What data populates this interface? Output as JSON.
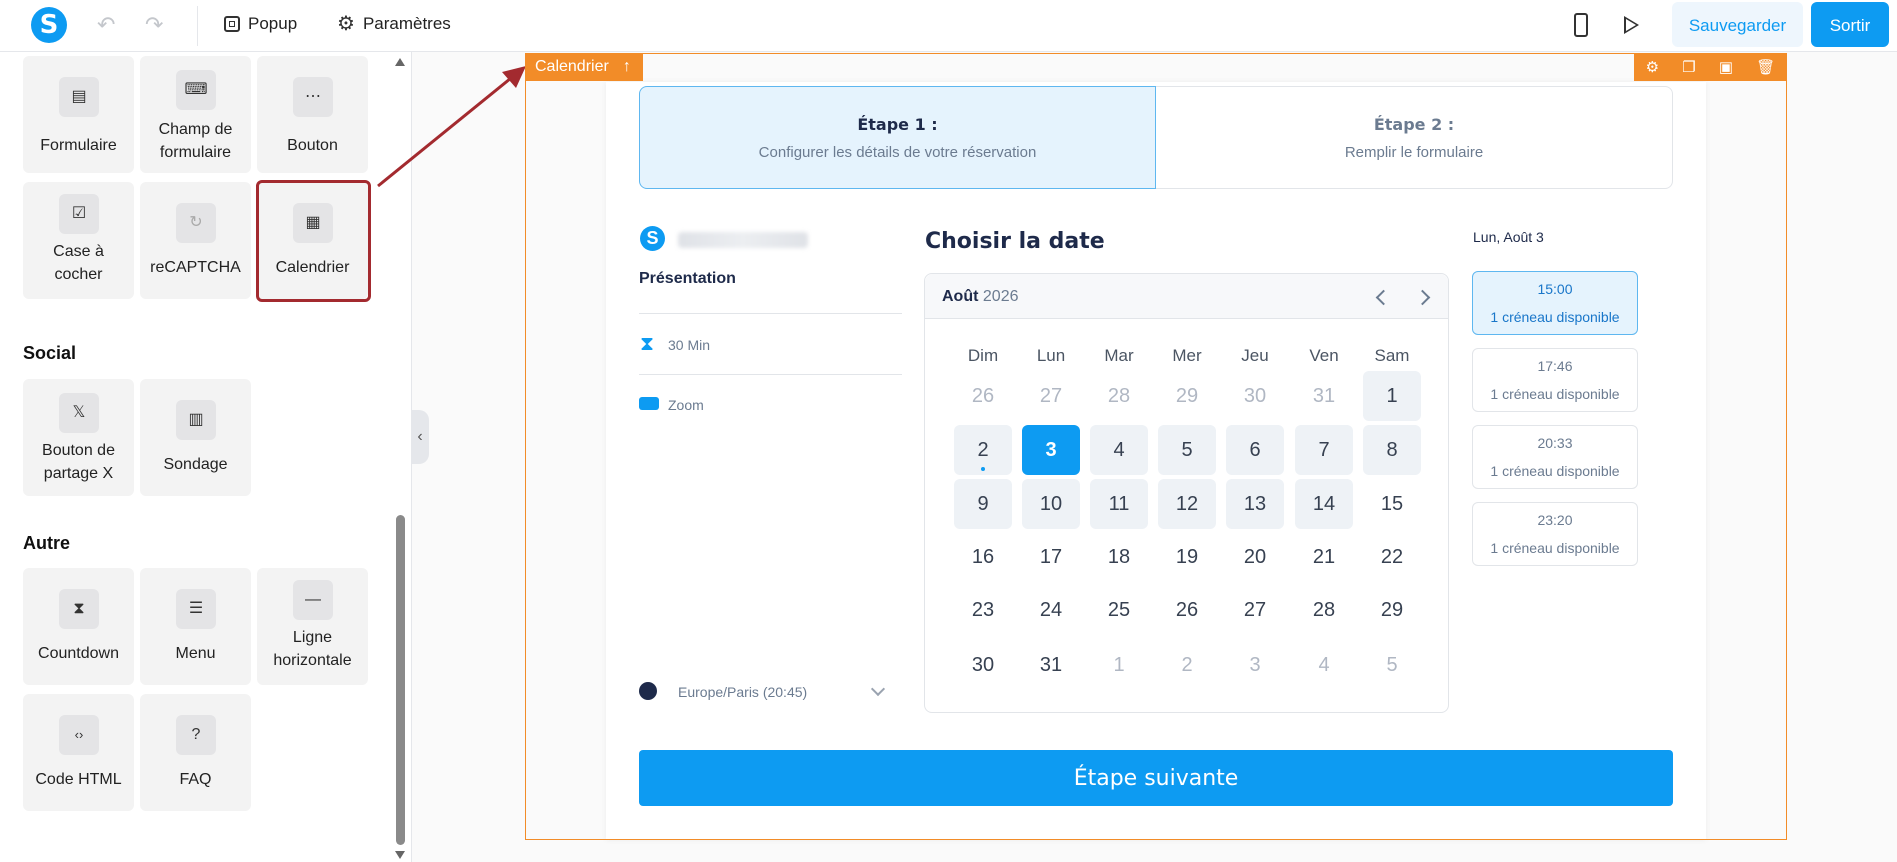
{
  "topbar": {
    "logo": "S",
    "undo": "↶",
    "redo": "↷",
    "popup_label": "Popup",
    "settings_label": "Paramètres",
    "save_label": "Sauvegarder",
    "exit_label": "Sortir"
  },
  "sidebar": {
    "items": [
      {
        "label": "Formulaire",
        "icon": "form-icon",
        "glyph": "▤"
      },
      {
        "label": "Champ de formulaire",
        "icon": "form-field-icon",
        "glyph": "⌨"
      },
      {
        "label": "Bouton",
        "icon": "button-icon",
        "glyph": "⋯"
      },
      {
        "label": "Case à cocher",
        "icon": "checkbox-icon",
        "glyph": "☑"
      },
      {
        "label": "reCAPTCHA",
        "icon": "recaptcha-icon",
        "glyph": "↻"
      },
      {
        "label": "Calendrier",
        "icon": "calendar-icon",
        "glyph": "▦"
      }
    ],
    "social_title": "Social",
    "social": [
      {
        "label": "Bouton de partage X",
        "icon": "x-share-icon",
        "glyph": "𝕏"
      },
      {
        "label": "Sondage",
        "icon": "poll-icon",
        "glyph": "▥"
      }
    ],
    "other_title": "Autre",
    "other": [
      {
        "label": "Countdown",
        "icon": "hourglass-icon",
        "glyph": "⧗"
      },
      {
        "label": "Menu",
        "icon": "menu-icon",
        "glyph": "☰"
      },
      {
        "label": "Ligne horizontale",
        "icon": "horizontal-line-icon",
        "glyph": "—"
      },
      {
        "label": "Code HTML",
        "icon": "code-icon",
        "glyph": "‹›"
      },
      {
        "label": "FAQ",
        "icon": "question-icon",
        "glyph": "?"
      }
    ]
  },
  "canvas": {
    "element_tag": "Calendrier",
    "tag_arrow": "↑",
    "steps": [
      {
        "title": "Étape 1 :",
        "subtitle": "Configurer les détails de votre réservation"
      },
      {
        "title": "Étape 2 :",
        "subtitle": "Remplir le formulaire"
      }
    ],
    "info": {
      "logo": "S",
      "section": "Présentation",
      "duration": "30 Min",
      "platform": "Zoom",
      "timezone": "Europe/Paris (20:45)"
    },
    "calendar": {
      "title": "Choisir la date",
      "month": "Août",
      "year": "2026",
      "weekdays": [
        "Dim",
        "Lun",
        "Mar",
        "Mer",
        "Jeu",
        "Ven",
        "Sam"
      ],
      "weeks": [
        [
          {
            "d": "26",
            "s": "muted"
          },
          {
            "d": "27",
            "s": "muted"
          },
          {
            "d": "28",
            "s": "muted"
          },
          {
            "d": "29",
            "s": "muted"
          },
          {
            "d": "30",
            "s": "muted"
          },
          {
            "d": "31",
            "s": "muted"
          },
          {
            "d": "1",
            "s": "avail"
          }
        ],
        [
          {
            "d": "2",
            "s": "avail",
            "dot": true
          },
          {
            "d": "3",
            "s": "sel"
          },
          {
            "d": "4",
            "s": "avail"
          },
          {
            "d": "5",
            "s": "avail"
          },
          {
            "d": "6",
            "s": "avail"
          },
          {
            "d": "7",
            "s": "avail"
          },
          {
            "d": "8",
            "s": "avail"
          }
        ],
        [
          {
            "d": "9",
            "s": "avail"
          },
          {
            "d": "10",
            "s": "avail"
          },
          {
            "d": "11",
            "s": "avail"
          },
          {
            "d": "12",
            "s": "avail"
          },
          {
            "d": "13",
            "s": "avail"
          },
          {
            "d": "14",
            "s": "avail"
          },
          {
            "d": "15",
            "s": ""
          }
        ],
        [
          {
            "d": "16",
            "s": ""
          },
          {
            "d": "17",
            "s": ""
          },
          {
            "d": "18",
            "s": ""
          },
          {
            "d": "19",
            "s": ""
          },
          {
            "d": "20",
            "s": ""
          },
          {
            "d": "21",
            "s": ""
          },
          {
            "d": "22",
            "s": ""
          }
        ],
        [
          {
            "d": "23",
            "s": ""
          },
          {
            "d": "24",
            "s": ""
          },
          {
            "d": "25",
            "s": ""
          },
          {
            "d": "26",
            "s": ""
          },
          {
            "d": "27",
            "s": ""
          },
          {
            "d": "28",
            "s": ""
          },
          {
            "d": "29",
            "s": ""
          }
        ],
        [
          {
            "d": "30",
            "s": ""
          },
          {
            "d": "31",
            "s": ""
          },
          {
            "d": "1",
            "s": "muted"
          },
          {
            "d": "2",
            "s": "muted"
          },
          {
            "d": "3",
            "s": "muted"
          },
          {
            "d": "4",
            "s": "muted"
          },
          {
            "d": "5",
            "s": "muted"
          }
        ]
      ]
    },
    "slots_date": "Lun, Août 3",
    "slots": [
      {
        "time": "15:00",
        "availability": "1 créneau disponible",
        "active": true
      },
      {
        "time": "17:46",
        "availability": "1 créneau disponible",
        "active": false
      },
      {
        "time": "20:33",
        "availability": "1 créneau disponible",
        "active": false
      },
      {
        "time": "23:20",
        "availability": "1 créneau disponible",
        "active": false
      }
    ],
    "next_label": "Étape suivante"
  },
  "colors": {
    "accent": "#0d9bf2",
    "frame": "#f28c28",
    "annotation": "#a32a2f"
  }
}
